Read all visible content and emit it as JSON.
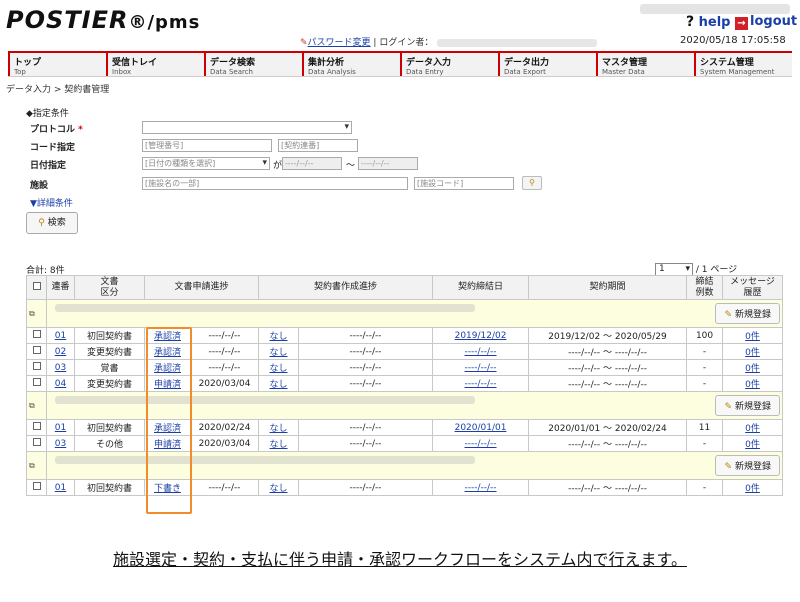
{
  "header": {
    "logo": "POSTIER",
    "logo_suffix": "®/pms",
    "help": "help",
    "logout": "logout",
    "password_change": "パスワード変更",
    "login_label": "ログイン者：",
    "datetime": "2020/05/18 17:05:58"
  },
  "nav": [
    {
      "ja": "トップ",
      "en": "Top"
    },
    {
      "ja": "受信トレイ",
      "en": "Inbox"
    },
    {
      "ja": "データ検索",
      "en": "Data Search"
    },
    {
      "ja": "集計分析",
      "en": "Data Analysis"
    },
    {
      "ja": "データ入力",
      "en": "Data Entry"
    },
    {
      "ja": "データ出力",
      "en": "Data Export"
    },
    {
      "ja": "マスタ管理",
      "en": "Master Data"
    },
    {
      "ja": "システム管理",
      "en": "System Management"
    }
  ],
  "breadcrumb": "データ入力 > 契約書管理",
  "conditions": {
    "title": "◆指定条件",
    "protocol_label": "プロトコル",
    "required_mark": "*",
    "code_label": "コード指定",
    "code_placeholder1": "[管理番号]",
    "code_placeholder2": "[契約連番]",
    "date_label": "日付指定",
    "date_type_placeholder": "[日付の種類を選択]",
    "date_ga": "が",
    "date_from": "----/--/--",
    "date_tilde": "〜",
    "date_to": "----/--/--",
    "facility_label": "施設",
    "facility_name_placeholder": "[施設名の一部]",
    "facility_code_placeholder": "[施設コード]",
    "detail_link": "▼詳細条件",
    "search_button": "検索"
  },
  "list": {
    "total": "合計:  8件",
    "page_select": "1",
    "page_suffix": "/ 1 ページ",
    "columns": [
      "",
      "連番",
      "文書区分",
      "文書申請進捗",
      "",
      "契約書作成進捗",
      "",
      "契約締結日",
      "契約期間",
      "締結例数",
      "メッセージ履歴"
    ],
    "header": {
      "seq": "連番",
      "doc_type_1": "文書",
      "doc_type_2": "区分",
      "app_progress": "文書申請進捗",
      "create_progress": "契約書作成進捗",
      "sign_date": "契約締結日",
      "period": "契約期間",
      "count_1": "締結",
      "count_2": "例数",
      "msg_1": "メッセージ",
      "msg_2": "履歴"
    },
    "new_button": "新規登録",
    "groups": [
      {
        "rows": [
          {
            "seq": "01",
            "type": "初回契約書",
            "status": "承認済",
            "status_date": "----/--/--",
            "create": "なし",
            "create_date": "----/--/--",
            "sign": "2019/12/02",
            "period": "2019/12/02 〜 2020/05/29",
            "count": "100",
            "msg": "0件"
          },
          {
            "seq": "02",
            "type": "変更契約書",
            "status": "承認済",
            "status_date": "----/--/--",
            "create": "なし",
            "create_date": "----/--/--",
            "sign": "----/--/--",
            "period": "----/--/-- 〜 ----/--/--",
            "count": "-",
            "msg": "0件"
          },
          {
            "seq": "03",
            "type": "覚書",
            "status": "承認済",
            "status_date": "----/--/--",
            "create": "なし",
            "create_date": "----/--/--",
            "sign": "----/--/--",
            "period": "----/--/-- 〜 ----/--/--",
            "count": "-",
            "msg": "0件"
          },
          {
            "seq": "04",
            "type": "変更契約書",
            "status": "申請済",
            "status_date": "2020/03/04",
            "create": "なし",
            "create_date": "----/--/--",
            "sign": "----/--/--",
            "period": "----/--/-- 〜 ----/--/--",
            "count": "-",
            "msg": "0件"
          }
        ]
      },
      {
        "rows": [
          {
            "seq": "01",
            "type": "初回契約書",
            "status": "承認済",
            "status_date": "2020/02/24",
            "create": "なし",
            "create_date": "----/--/--",
            "sign": "2020/01/01",
            "period": "2020/01/01 〜 2020/02/24",
            "count": "11",
            "msg": "0件"
          },
          {
            "seq": "03",
            "type": "その他",
            "status": "申請済",
            "status_date": "2020/03/04",
            "create": "なし",
            "create_date": "----/--/--",
            "sign": "----/--/--",
            "period": "----/--/-- 〜 ----/--/--",
            "count": "-",
            "msg": "0件"
          }
        ]
      },
      {
        "rows": [
          {
            "seq": "01",
            "type": "初回契約書",
            "status": "下書き",
            "status_date": "----/--/--",
            "create": "なし",
            "create_date": "----/--/--",
            "sign": "----/--/--",
            "period": "----/--/-- 〜 ----/--/--",
            "count": "-",
            "msg": "0件"
          }
        ]
      }
    ]
  },
  "caption": "施設選定・契約・支払に伴う申請・承認ワークフローをシステム内で行えます。",
  "colors": {
    "accent": "#cc0000",
    "link": "#1a3fa8",
    "highlight": "#f08c2a",
    "group_bg": "#fdfde0"
  }
}
